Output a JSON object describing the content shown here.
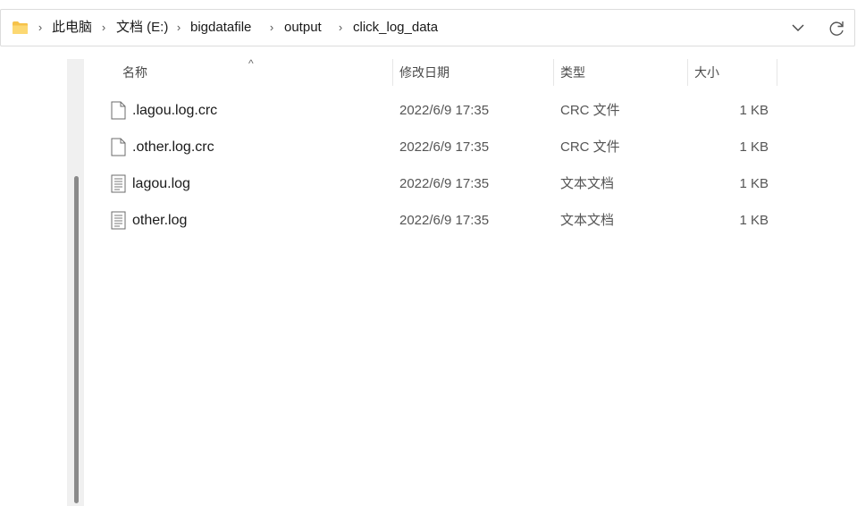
{
  "breadcrumb": [
    "此电脑",
    "文档 (E:)",
    "bigdatafile",
    "output",
    "click_log_data"
  ],
  "columns": {
    "name": "名称",
    "date": "修改日期",
    "type": "类型",
    "size": "大小"
  },
  "files": [
    {
      "name": ".lagou.log.crc",
      "date": "2022/6/9 17:35",
      "type": "CRC 文件",
      "size": "1 KB",
      "icon": "blank-file-icon"
    },
    {
      "name": ".other.log.crc",
      "date": "2022/6/9 17:35",
      "type": "CRC 文件",
      "size": "1 KB",
      "icon": "blank-file-icon"
    },
    {
      "name": "lagou.log",
      "date": "2022/6/9 17:35",
      "type": "文本文档",
      "size": "1 KB",
      "icon": "text-file-icon"
    },
    {
      "name": "other.log",
      "date": "2022/6/9 17:35",
      "type": "文本文档",
      "size": "1 KB",
      "icon": "text-file-icon"
    }
  ],
  "colors": {
    "folder": "#f6c24a",
    "scrollthumb": "#8a8a8a",
    "border": "#dcdcdc"
  }
}
